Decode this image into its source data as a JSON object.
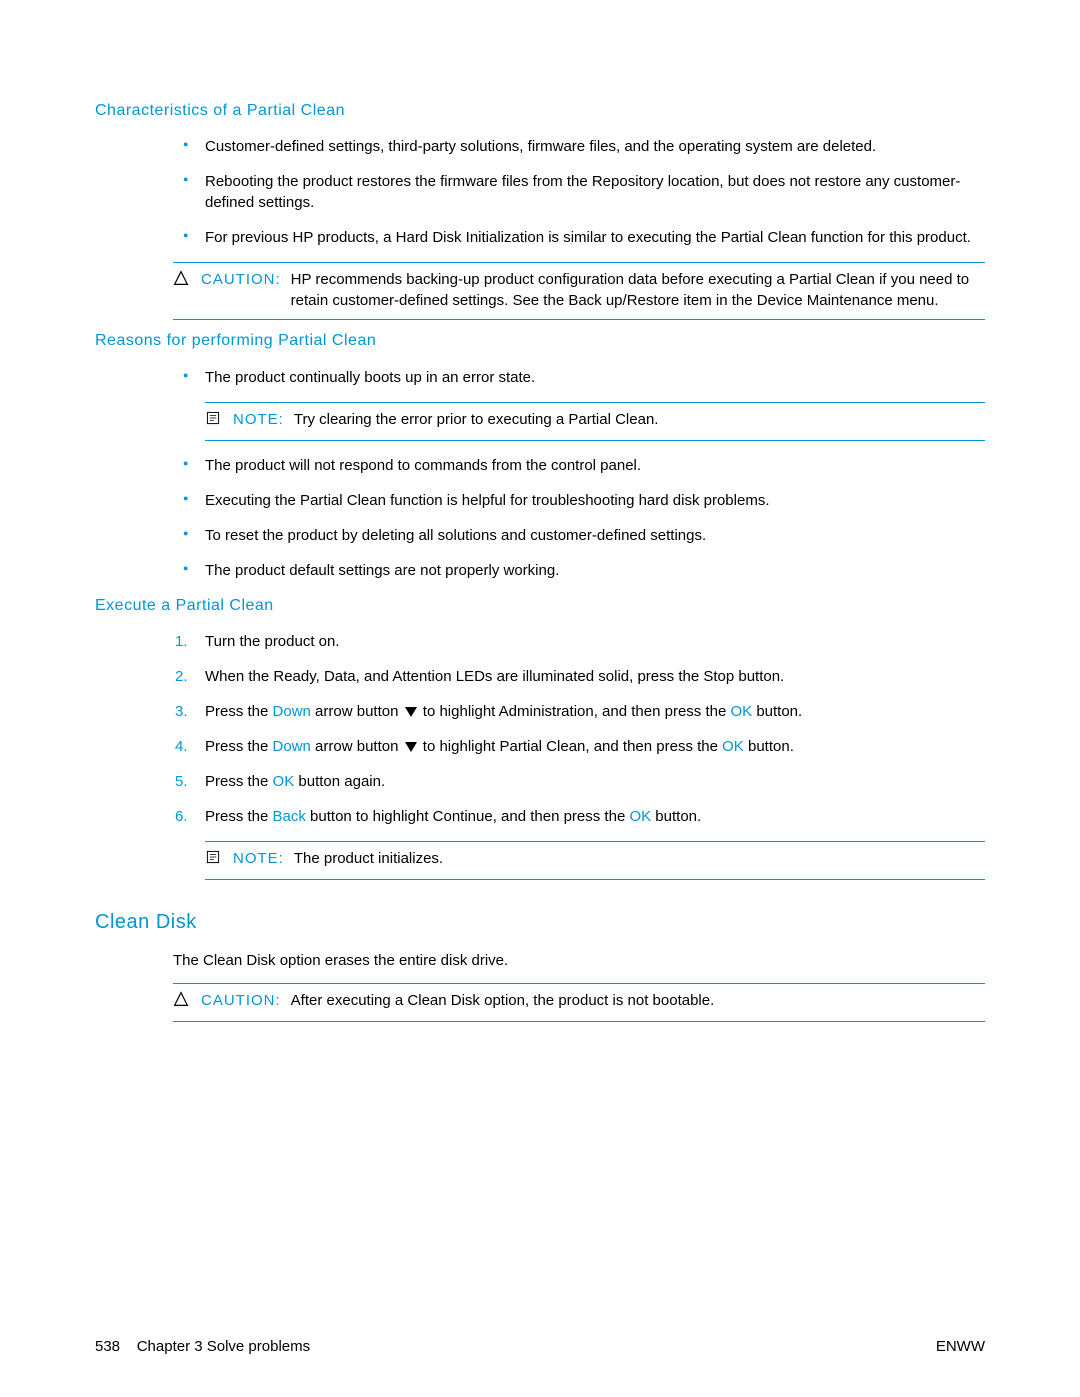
{
  "h_characteristics": "Characteristics of a Partial Clean",
  "char_bullets": [
    "Customer-defined settings, third-party solutions, firmware files, and the operating system are deleted.",
    "Rebooting the product restores the firmware files from the Repository location, but does not restore any customer-defined settings.",
    "For previous HP products, a Hard Disk Initialization is similar to executing the Partial Clean function for this product."
  ],
  "caution1_label": "CAUTION:",
  "caution1_text": "HP recommends backing-up product configuration data before executing a Partial Clean if you need to retain customer-defined settings. See the Back up/Restore item in the Device Maintenance menu.",
  "h_reasons": "Reasons for performing Partial Clean",
  "reason_bullet1": "The product continually boots up in an error state.",
  "note1_label": "NOTE:",
  "note1_text": "Try clearing the error prior to executing a Partial Clean.",
  "reason_bullets_rest": [
    "The product will not respond to commands from the control panel.",
    "Executing the Partial Clean function is helpful for troubleshooting hard disk problems.",
    "To reset the product by deleting all solutions and customer-defined settings.",
    "The product default settings are not properly working."
  ],
  "h_execute": "Execute a Partial Clean",
  "steps": {
    "s1": "Turn the product on.",
    "s2": "When the Ready, Data, and Attention LEDs are illuminated solid, press the Stop button.",
    "s3_a": "Press the ",
    "s3_b": "Down",
    "s3_c": " arrow button ",
    "s3_d": " to highlight Administration, and then press the ",
    "s3_e": "OK",
    "s3_f": " button.",
    "s4_a": "Press the ",
    "s4_b": "Down",
    "s4_c": " arrow button ",
    "s4_d": " to highlight Partial Clean, and then press the ",
    "s4_e": "OK",
    "s4_f": " button.",
    "s5_a": "Press the ",
    "s5_b": "OK",
    "s5_c": " button again.",
    "s6_a": "Press the ",
    "s6_b": "Back",
    "s6_c": " button to highlight Continue, and then press the ",
    "s6_d": "OK",
    "s6_e": " button."
  },
  "note2_label": "NOTE:",
  "note2_text": "The product initializes.",
  "h_clean_disk": "Clean Disk",
  "clean_disk_text": "The Clean Disk option erases the entire disk drive.",
  "caution2_label": "CAUTION:",
  "caution2_text": "After executing a Clean Disk option, the product is not bootable.",
  "footer_page": "538",
  "footer_chapter": "Chapter 3   Solve problems",
  "footer_right": "ENWW"
}
